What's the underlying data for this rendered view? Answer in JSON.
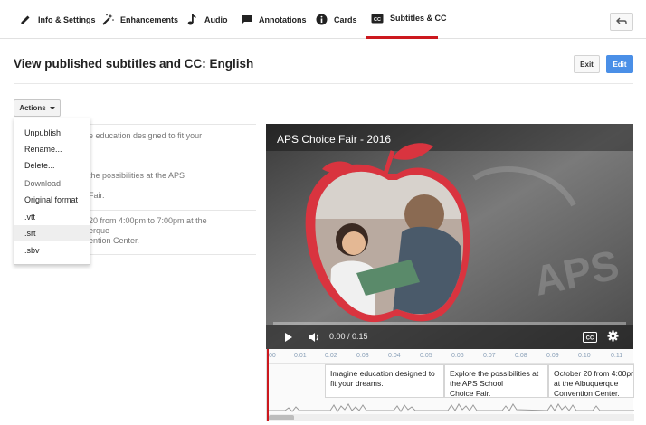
{
  "tabs": [
    {
      "label": "Info & Settings",
      "icon": "pencil-icon"
    },
    {
      "label": "Enhancements",
      "icon": "magic-wand-icon"
    },
    {
      "label": "Audio",
      "icon": "music-note-icon"
    },
    {
      "label": "Annotations",
      "icon": "speech-bubble-icon"
    },
    {
      "label": "Cards",
      "icon": "info-icon"
    },
    {
      "label": "Subtitles & CC",
      "icon": "cc-icon",
      "active": true
    }
  ],
  "header": {
    "title": "View published subtitles and CC: English",
    "exit_label": "Exit",
    "edit_label": "Edit"
  },
  "actions": {
    "label": "Actions",
    "menu": [
      "Unpublish",
      "Rename...",
      "Delete...",
      "Download",
      "Original format",
      ".vtt",
      ".srt",
      ".sbv"
    ],
    "highlighted": ".srt"
  },
  "subtitle_rows": [
    {
      "line1": "e education designed to fit your",
      "line2": ""
    },
    {
      "line1": "the possibilities at the APS",
      "line2": "Fair."
    },
    {
      "line1": "20 from 4:00pm to 7:00pm at the",
      "line2": "erque",
      "line3": "ention Center."
    }
  ],
  "video": {
    "title": "APS Choice Fair - 2016",
    "time": "0:00 / 0:15",
    "cc_label": "CC"
  },
  "timeline": {
    "ticks": [
      "00",
      "0:01",
      "0:02",
      "0:03",
      "0:04",
      "0:05",
      "0:06",
      "0:07",
      "0:08",
      "0:09",
      "0:10",
      "0:11"
    ],
    "captions": [
      {
        "line1": "Imagine education designed to",
        "line2": "fit your dreams."
      },
      {
        "line1": "Explore the possibilities at",
        "line2": "the APS School",
        "line3": "Choice Fair."
      },
      {
        "line1": "October 20 from 4:00pm",
        "line2": "at the Albuquerque",
        "line3": "Convention Center."
      }
    ]
  },
  "colors": {
    "accent_red": "#cc181e",
    "edit_blue": "#4a8fe7",
    "apple_red": "#d9343f"
  }
}
